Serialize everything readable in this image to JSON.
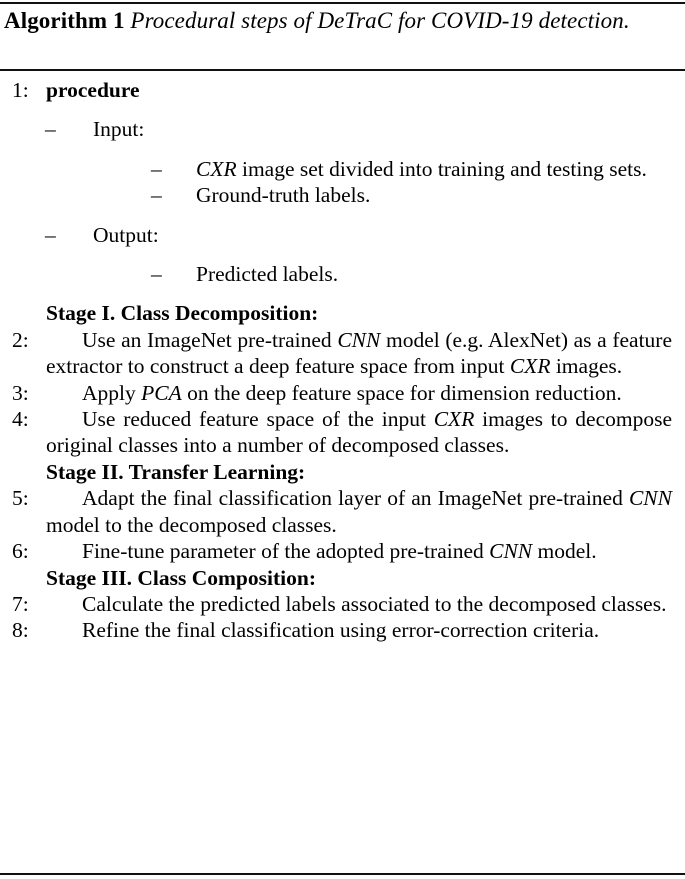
{
  "figure": {
    "kind": "algorithm-float",
    "background": "#ffffff",
    "ink": "#000000"
  },
  "caption": {
    "label": "Algorithm 1",
    "title": "Procedural steps of DeTraC for COVID-19 detection."
  },
  "body": {
    "procedure": {
      "number": "1:",
      "keyword": "procedure"
    },
    "input": {
      "dash": "–",
      "label": "Input:",
      "items": [
        {
          "dash": "–",
          "emph": "CXR",
          "rest": " image set divided into training and testing sets."
        },
        {
          "dash": "–",
          "emph": "",
          "rest": "Ground-truth labels."
        }
      ]
    },
    "output": {
      "dash": "–",
      "label": "Output:",
      "items": [
        {
          "dash": "–",
          "emph": "",
          "rest": "Predicted labels."
        }
      ]
    },
    "stages": [
      {
        "heading": "Stage I. Class Decomposition:",
        "steps": [
          {
            "number": "2:",
            "parts": [
              {
                "text": "Use an ImageNet pre-trained ",
                "italic": false
              },
              {
                "text": "CNN",
                "italic": true
              },
              {
                "text": " model (e.g. AlexNet) as a feature extractor to construct a deep feature space from input ",
                "italic": false
              },
              {
                "text": "CXR",
                "italic": true
              },
              {
                "text": " images.",
                "italic": false
              }
            ]
          },
          {
            "number": "3:",
            "parts": [
              {
                "text": "Apply ",
                "italic": false
              },
              {
                "text": "PCA",
                "italic": true
              },
              {
                "text": " on the deep feature space for dimension reduction.",
                "italic": false
              }
            ]
          },
          {
            "number": "4:",
            "parts": [
              {
                "text": "Use reduced feature space of the input ",
                "italic": false
              },
              {
                "text": "CXR",
                "italic": true
              },
              {
                "text": " images to decompose original classes into a number of decomposed classes.",
                "italic": false
              }
            ]
          }
        ]
      },
      {
        "heading": "Stage II. Transfer Learning:",
        "steps": [
          {
            "number": "5:",
            "parts": [
              {
                "text": "Adapt the final classification layer of an ImageNet pre-trained ",
                "italic": false
              },
              {
                "text": "CNN",
                "italic": true
              },
              {
                "text": " model to the decomposed classes.",
                "italic": false
              }
            ]
          },
          {
            "number": "6:",
            "parts": [
              {
                "text": "Fine-tune parameter of the adopted pre-trained ",
                "italic": false
              },
              {
                "text": "CNN",
                "italic": true
              },
              {
                "text": " model.",
                "italic": false
              }
            ]
          }
        ]
      },
      {
        "heading": "Stage III. Class Composition:",
        "steps": [
          {
            "number": "7:",
            "parts": [
              {
                "text": "Calculate the predicted labels associated to the decomposed classes.",
                "italic": false
              }
            ]
          },
          {
            "number": "8:",
            "parts": [
              {
                "text": "Refine the final classification using error-correction criteria.",
                "italic": false
              }
            ]
          }
        ]
      }
    ]
  }
}
